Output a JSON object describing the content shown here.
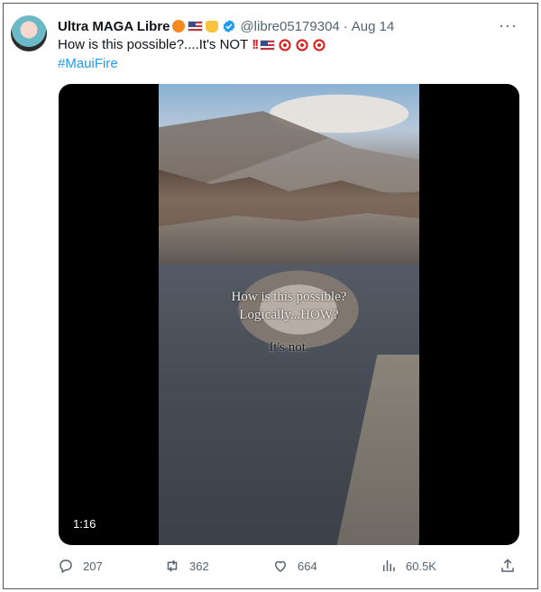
{
  "tweet": {
    "author_name": "Ultra MAGA Libre",
    "handle": "@libre05179304",
    "separator": "·",
    "date": "Aug 14",
    "more_label": "···",
    "text": "How is this possible?....It's NOT",
    "hashtag": "#MauiFire",
    "emoji_icons": [
      "orange-circle-icon",
      "us-flag-icon",
      "fist-icon",
      "verified-badge-icon"
    ],
    "text_emoji_icons": [
      "double-exclamation-icon",
      "us-flag-icon",
      "target-icon",
      "target-icon",
      "target-icon"
    ]
  },
  "video": {
    "overlay_lines": [
      "How is this possible?",
      "Logically...HOW?",
      "It's not."
    ],
    "duration": "1:16"
  },
  "actions": {
    "replies": "207",
    "retweets": "362",
    "likes": "664",
    "views": "60.5K"
  },
  "colors": {
    "link": "#1d9bf0",
    "muted": "#536471",
    "verified": "#1d9bf0"
  }
}
